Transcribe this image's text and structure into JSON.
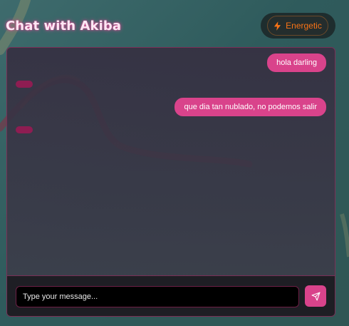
{
  "header": {
    "title": "Chat with Akiba",
    "mood_label": "Energetic",
    "mood_icon": "lightning-icon"
  },
  "messages": [
    {
      "role": "user",
      "text": "hola darling"
    },
    {
      "role": "assistant",
      "text": ""
    },
    {
      "role": "user",
      "text": "que dia tan nublado, no podemos salir"
    },
    {
      "role": "assistant",
      "text": ""
    }
  ],
  "composer": {
    "placeholder": "Type your message...",
    "value": "",
    "send_icon": "send-icon"
  },
  "colors": {
    "accent": "#d9438b",
    "mood": "#f97316",
    "assistant_bubble": "#8e1d52",
    "background": "#3e6b6d"
  }
}
